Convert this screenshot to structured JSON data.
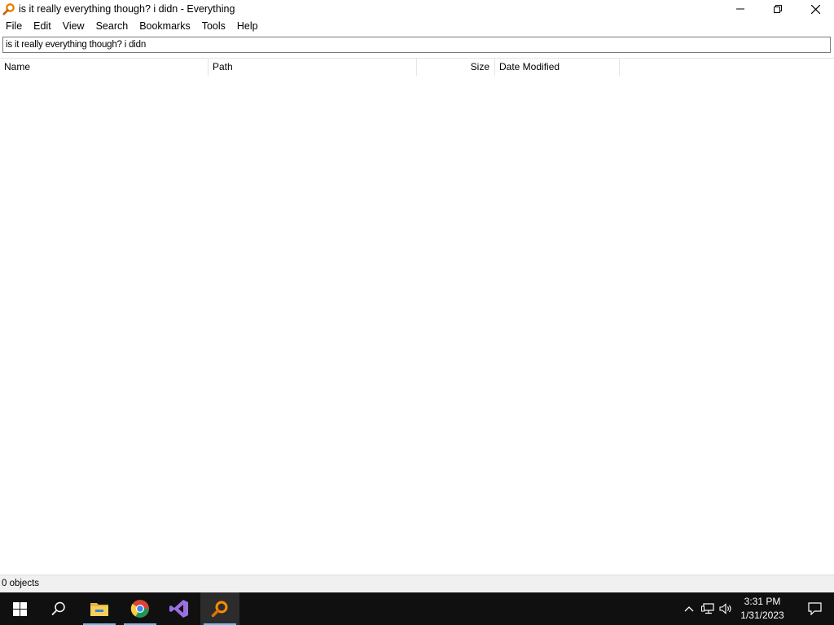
{
  "window": {
    "title": "is it really everything though? i didn - Everything",
    "controls": {
      "minimize": "minimize-icon",
      "maximize": "restore-icon",
      "close": "close-icon"
    }
  },
  "menu": {
    "items": [
      "File",
      "Edit",
      "View",
      "Search",
      "Bookmarks",
      "Tools",
      "Help"
    ]
  },
  "search": {
    "value": "is it really everything though? i didn"
  },
  "columns": [
    "Name",
    "Path",
    "Size",
    "Date Modified"
  ],
  "results": [],
  "status": {
    "text": "0 objects"
  },
  "taskbar": {
    "apps": [
      "windows-start-icon",
      "search-icon",
      "file-explorer-icon",
      "chrome-icon",
      "visual-studio-icon",
      "everything-icon"
    ],
    "clock": {
      "time": "3:31 PM",
      "date": "1/31/2023"
    }
  },
  "colors": {
    "accent": "#ff8c00",
    "taskbar_bg": "#101010",
    "underline": "#76b9ed"
  }
}
